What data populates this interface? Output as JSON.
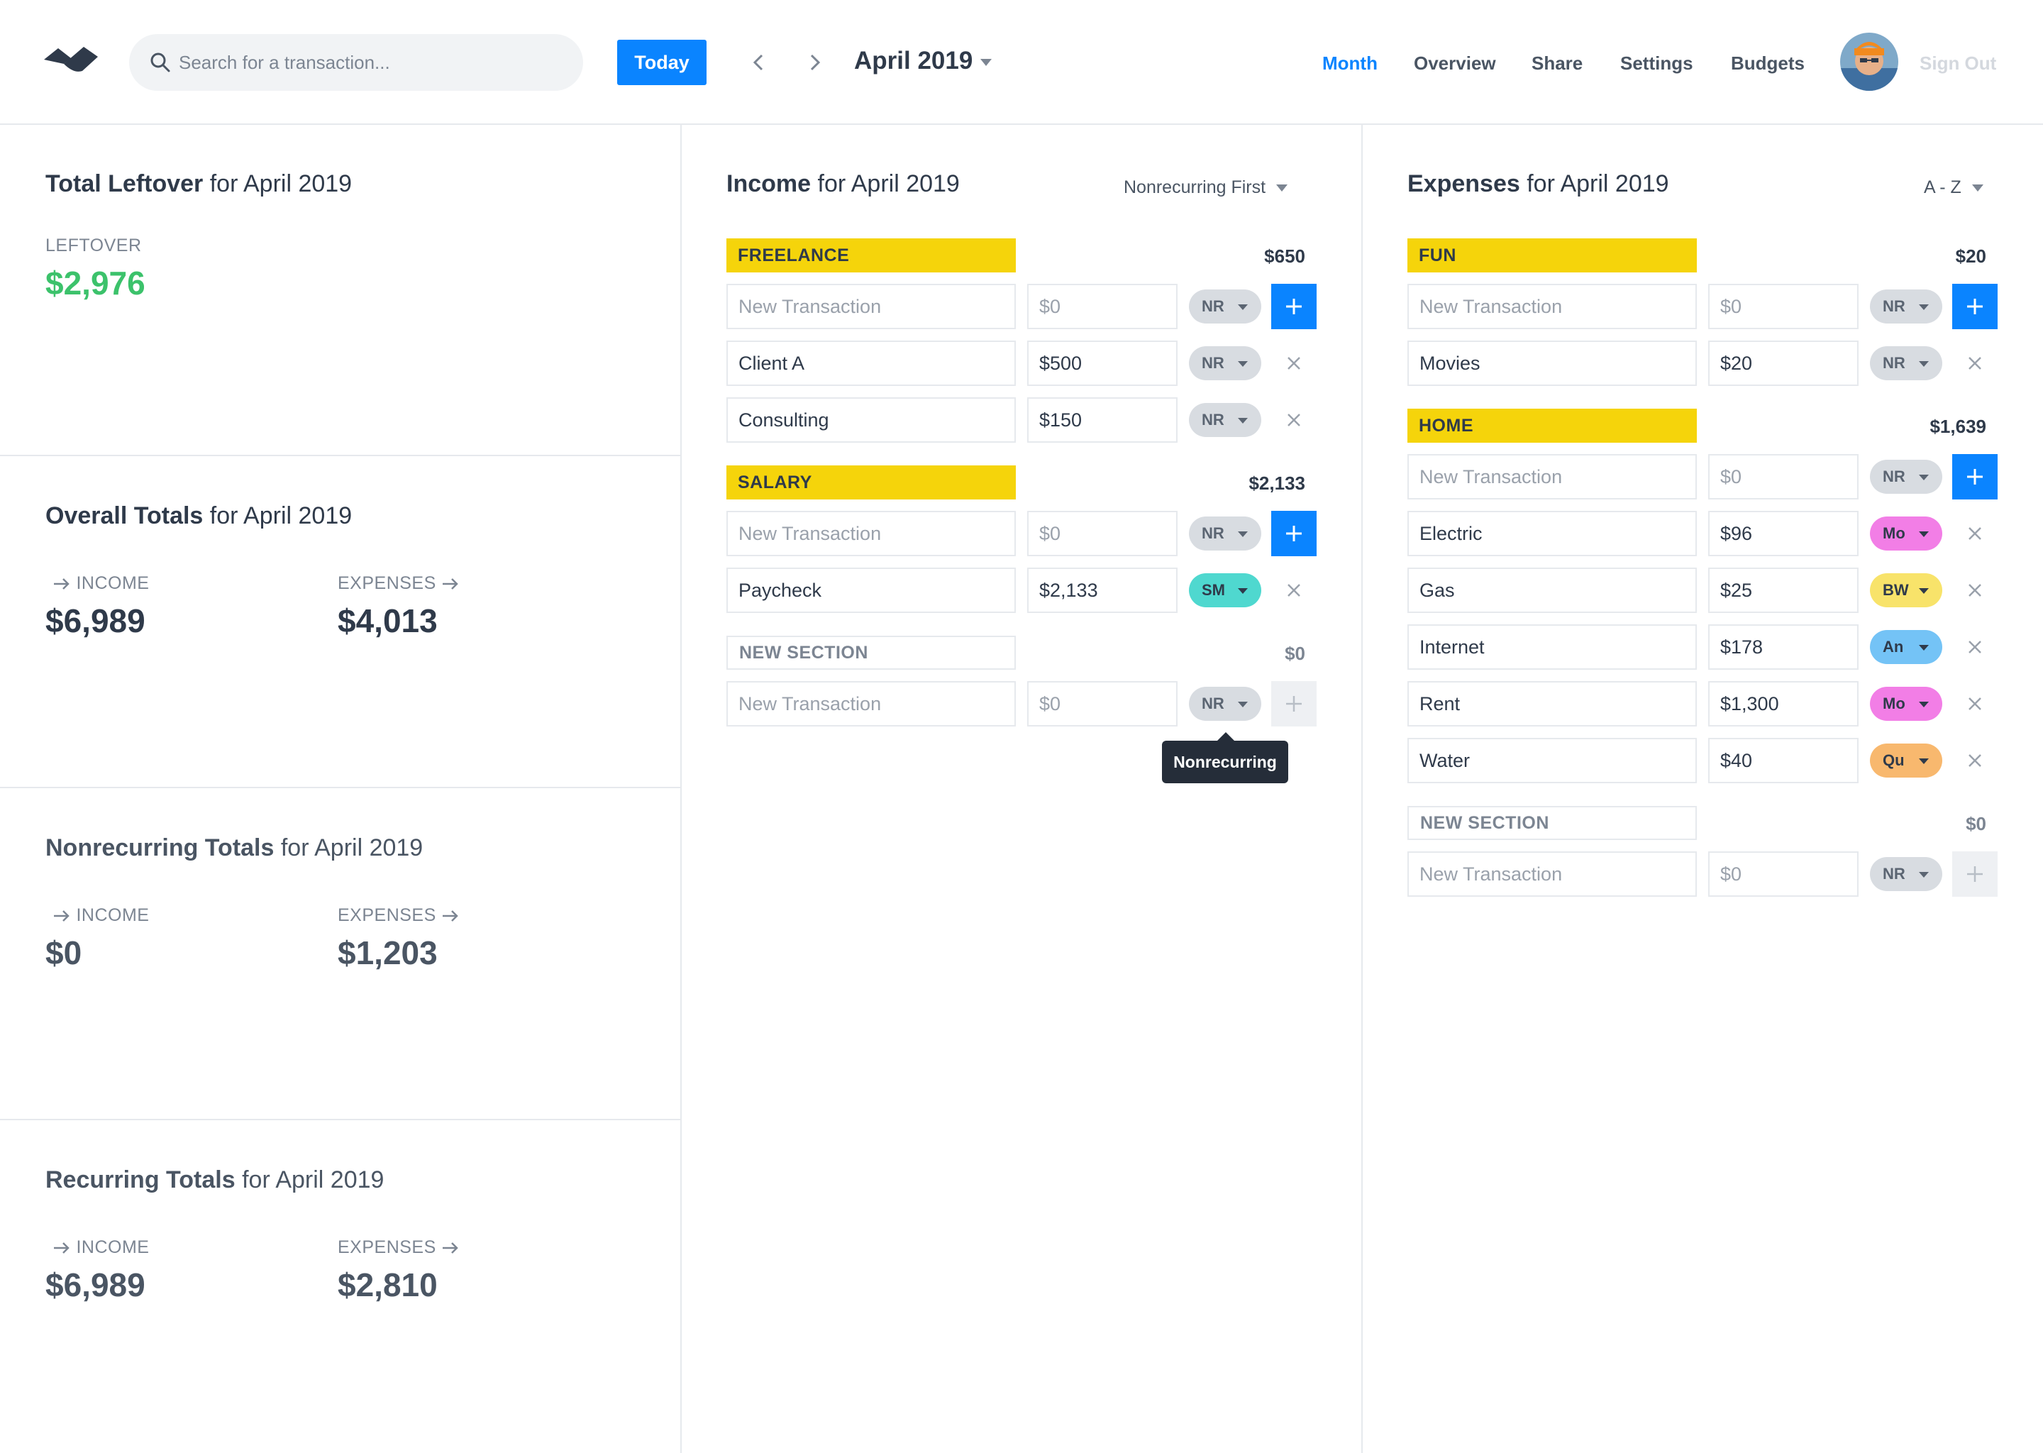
{
  "header": {
    "search_placeholder": "Search for a transaction...",
    "today_label": "Today",
    "month_title": "April 2019",
    "nav": [
      "Month",
      "Overview",
      "Share",
      "Settings",
      "Budgets"
    ],
    "active_nav": "Month",
    "signout_label": "Sign Out"
  },
  "summary": {
    "leftover": {
      "title_bold": "Total Leftover",
      "title_rest": " for April 2019",
      "label": "LEFTOVER",
      "value": "$2,976"
    },
    "overall": {
      "title_bold": "Overall Totals",
      "title_rest": " for April 2019",
      "income_label": "INCOME",
      "income_value": "$6,989",
      "expenses_label": "EXPENSES",
      "expenses_value": "$4,013"
    },
    "nonrecurring": {
      "title_bold": "Nonrecurring Totals",
      "title_rest": " for April 2019",
      "income_label": "INCOME",
      "income_value": "$0",
      "expenses_label": "EXPENSES",
      "expenses_value": "$1,203"
    },
    "recurring": {
      "title_bold": "Recurring Totals",
      "title_rest": " for April 2019",
      "income_label": "INCOME",
      "income_value": "$6,989",
      "expenses_label": "EXPENSES",
      "expenses_value": "$2,810"
    }
  },
  "income": {
    "title_bold": "Income",
    "title_rest": " for April 2019",
    "sort_label": "Nonrecurring First",
    "new_transaction_placeholder": "New Transaction",
    "amount_placeholder": "$0",
    "sections": [
      {
        "name": "FREELANCE",
        "total": "$650",
        "rows": [
          {
            "name": "Client A",
            "amount": "$500",
            "tag": "NR"
          },
          {
            "name": "Consulting",
            "amount": "$150",
            "tag": "NR"
          }
        ]
      },
      {
        "name": "SALARY",
        "total": "$2,133",
        "rows": [
          {
            "name": "Paycheck",
            "amount": "$2,133",
            "tag": "SM"
          }
        ]
      },
      {
        "name": "NEW SECTION",
        "total": "$0",
        "rows": []
      }
    ],
    "tooltip": "Nonrecurring"
  },
  "expenses": {
    "title_bold": "Expenses",
    "title_rest": " for April 2019",
    "sort_label": "A - Z",
    "new_transaction_placeholder": "New Transaction",
    "amount_placeholder": "$0",
    "sections": [
      {
        "name": "FUN",
        "total": "$20",
        "rows": [
          {
            "name": "Movies",
            "amount": "$20",
            "tag": "NR"
          }
        ]
      },
      {
        "name": "HOME",
        "total": "$1,639",
        "rows": [
          {
            "name": "Electric",
            "amount": "$96",
            "tag": "Mo"
          },
          {
            "name": "Gas",
            "amount": "$25",
            "tag": "BW"
          },
          {
            "name": "Internet",
            "amount": "$178",
            "tag": "An"
          },
          {
            "name": "Rent",
            "amount": "$1,300",
            "tag": "Mo"
          },
          {
            "name": "Water",
            "amount": "$40",
            "tag": "Qu"
          }
        ]
      },
      {
        "name": "NEW SECTION",
        "total": "$0",
        "rows": []
      }
    ]
  },
  "new_tag": "NR",
  "colors": {
    "accent": "#0a84ff",
    "section": "#f5d40b",
    "leftover": "#3cc26b"
  }
}
